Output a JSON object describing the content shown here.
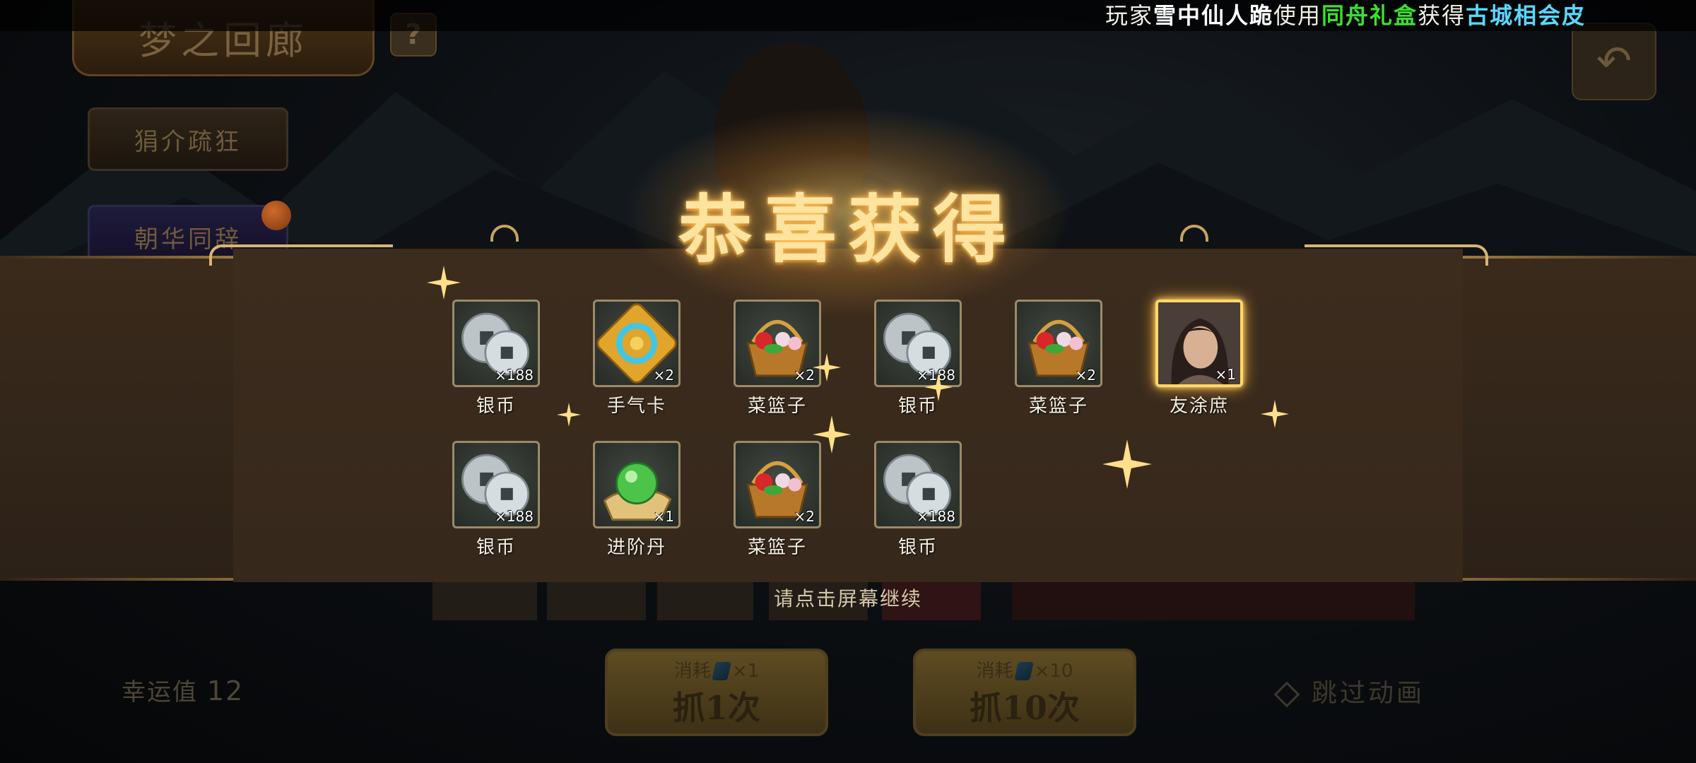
{
  "background": {
    "title": "梦之回廊",
    "help_label": "?",
    "tab1": "狷介疏狂",
    "tab2": "朝华同辞",
    "luck_label": "幸运值",
    "luck_value": "12",
    "draw_one": {
      "cost": "消耗",
      "cost_qty": "×1",
      "label": "抓1次"
    },
    "draw_ten": {
      "cost": "消耗",
      "cost_qty": "×10",
      "label": "抓10次"
    },
    "skip": "跳过动画"
  },
  "marquee": {
    "prefix": "玩家",
    "player": "雪中仙人跪",
    "verb": "使用",
    "item": "同舟礼盒",
    "gain": "获得",
    "reward": "古城相会皮"
  },
  "reward_panel": {
    "title": "恭喜获得",
    "hint": "请点击屏幕继续",
    "items": [
      {
        "name": "银币",
        "count": "×188",
        "icon": "silver-coin-icon"
      },
      {
        "name": "手气卡",
        "count": "×2",
        "icon": "luck-card-icon"
      },
      {
        "name": "菜篮子",
        "count": "×2",
        "icon": "basket-icon"
      },
      {
        "name": "银币",
        "count": "×188",
        "icon": "silver-coin-icon"
      },
      {
        "name": "菜篮子",
        "count": "×2",
        "icon": "basket-icon"
      },
      {
        "name": "友涂庶",
        "count": "×1",
        "icon": "hero-portrait-icon"
      },
      {
        "name": "银币",
        "count": "×188",
        "icon": "silver-coin-icon"
      },
      {
        "name": "进阶丹",
        "count": "×1",
        "icon": "advance-pill-icon"
      },
      {
        "name": "菜篮子",
        "count": "×2",
        "icon": "basket-icon"
      },
      {
        "name": "银币",
        "count": "×188",
        "icon": "silver-coin-icon"
      }
    ]
  },
  "colors": {
    "marquee_player": "#ffffff",
    "marquee_item": "#38e22e",
    "marquee_reward": "#58d8ff",
    "title_gold": "#ffe4a0",
    "frame_border": "#9c8a68",
    "hero_frame": "#ffd76a"
  }
}
